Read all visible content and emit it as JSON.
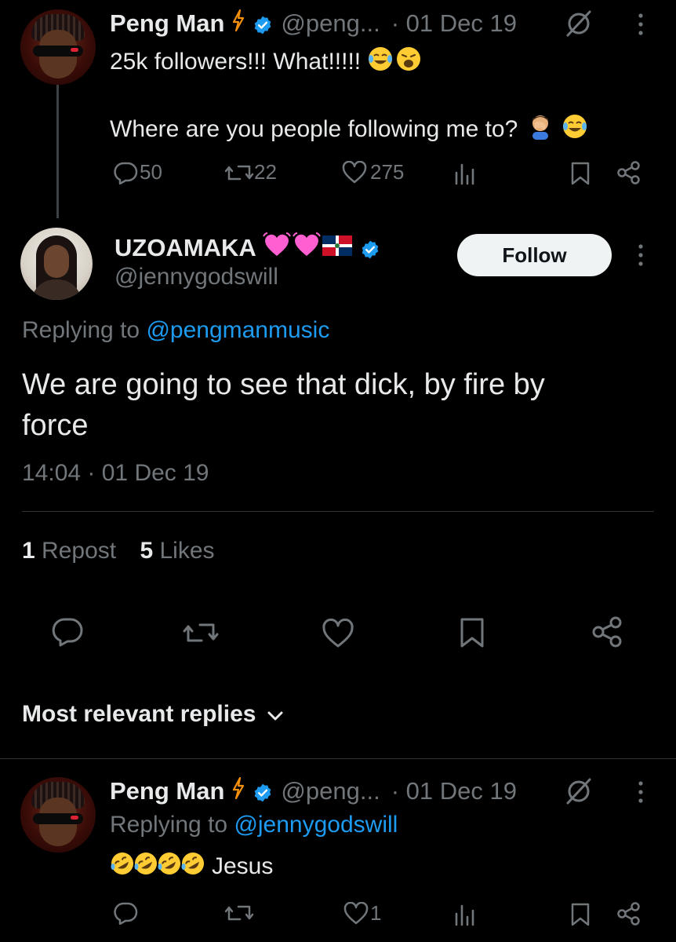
{
  "parent_tweet": {
    "author_name": "Peng Man",
    "handle": "@peng...",
    "date": "· 01 Dec 19",
    "text_line1": "25k followers!!! What!!!!!",
    "text_line2": "Where are you people following me to?",
    "replies": "50",
    "reposts": "22",
    "likes": "275"
  },
  "main_tweet": {
    "author_name": "UZOAMAKA",
    "handle": "@jennygodswill",
    "follow_label": "Follow",
    "replying_prefix": "Replying to",
    "replying_to": "@pengmanmusic",
    "text_line1": "We are going to see that dick, by fire by",
    "text_line2": "force",
    "timestamp": "14:04 · 01 Dec 19",
    "repost_count": "1",
    "repost_label": "Repost",
    "like_count": "5",
    "like_label": "Likes"
  },
  "replies_sort": {
    "label": "Most relevant replies"
  },
  "reply_tweet": {
    "author_name": "Peng Man",
    "handle": "@peng...",
    "date": "· 01 Dec 19",
    "replying_prefix": "Replying to",
    "replying_to": "@jennygodswill",
    "text": "Jesus",
    "likes": "1"
  },
  "colors": {
    "background": "#000000",
    "text": "#e7e9ea",
    "muted": "#71767b",
    "link": "#1d9bf0",
    "verified": "#1d9bf0",
    "bolt": "#f4900c"
  },
  "icons": [
    "bolt-icon",
    "verified-icon",
    "grok-icon",
    "more-icon",
    "reply-icon",
    "repost-icon",
    "like-icon",
    "views-icon",
    "bookmark-icon",
    "share-icon",
    "chevron-down-icon"
  ]
}
